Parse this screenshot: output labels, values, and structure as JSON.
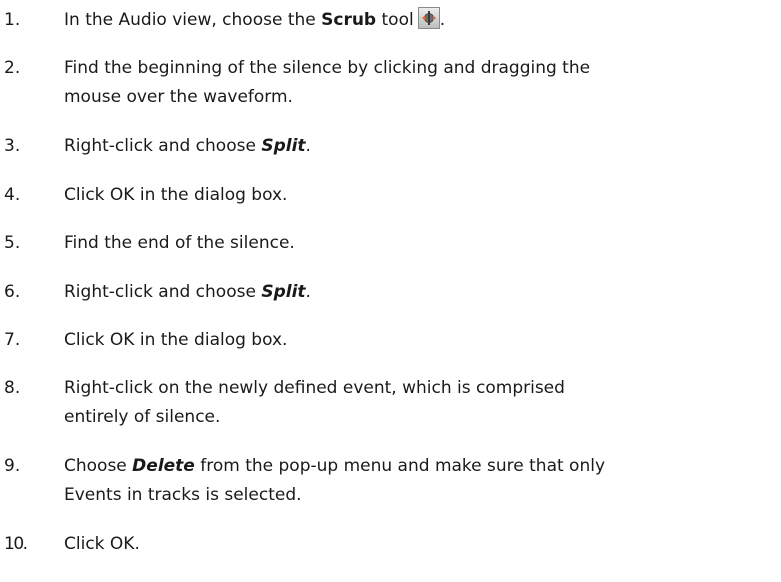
{
  "steps": [
    {
      "number": "1.",
      "pre": "In the Audio view, choose the ",
      "bold": "Scrub",
      "post": " tool",
      "icon": "scrub-tool-icon",
      "end": "."
    },
    {
      "number": "2.",
      "line1": "Find the beginning of the silence by clicking and dragging the",
      "line2": "mouse over the waveform."
    },
    {
      "number": "3.",
      "pre": "Right-click and choose ",
      "emph": "Split",
      "post": "."
    },
    {
      "number": "4.",
      "text": "Click OK in the dialog box."
    },
    {
      "number": "5.",
      "text": "Find the end of the silence."
    },
    {
      "number": "6.",
      "pre": "Right-click and choose ",
      "emph": "Split",
      "post": "."
    },
    {
      "number": "7.",
      "text": "Click OK in the dialog box."
    },
    {
      "number": "8.",
      "line1": "Right-click on the newly defined event, which is comprised",
      "line2": "entirely of silence."
    },
    {
      "number": "9.",
      "pre": "Choose ",
      "emph": "Delete",
      "post": " from the pop-up menu and make sure that only",
      "line2": "Events in tracks is selected."
    },
    {
      "number": "10.",
      "text": "Click OK."
    }
  ]
}
